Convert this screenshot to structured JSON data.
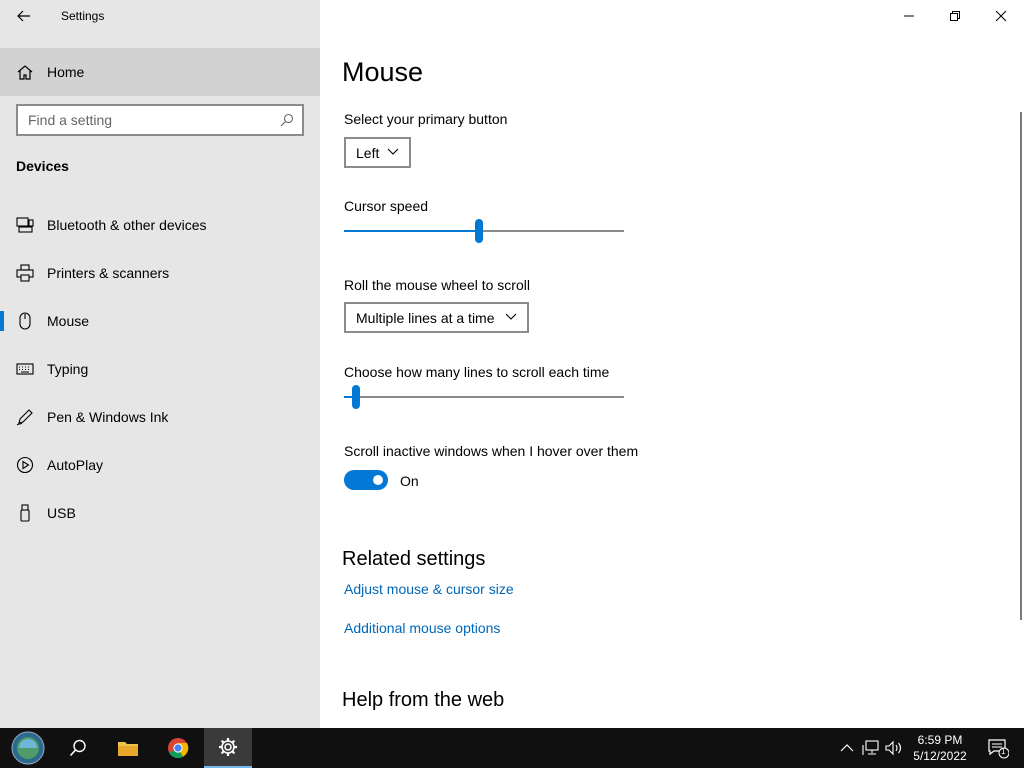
{
  "window": {
    "title": "Settings",
    "controls": {
      "minimize": "minimize",
      "maximize": "restore",
      "close": "close"
    }
  },
  "sidebar": {
    "home_label": "Home",
    "search_placeholder": "Find a setting",
    "section_heading": "Devices",
    "items": [
      {
        "label": "Bluetooth & other devices",
        "icon": "bluetooth-devices-icon",
        "selected": false
      },
      {
        "label": "Printers & scanners",
        "icon": "printer-icon",
        "selected": false
      },
      {
        "label": "Mouse",
        "icon": "mouse-icon",
        "selected": true
      },
      {
        "label": "Typing",
        "icon": "keyboard-icon",
        "selected": false
      },
      {
        "label": "Pen & Windows Ink",
        "icon": "pen-icon",
        "selected": false
      },
      {
        "label": "AutoPlay",
        "icon": "autoplay-icon",
        "selected": false
      },
      {
        "label": "USB",
        "icon": "usb-icon",
        "selected": false
      }
    ]
  },
  "main": {
    "title": "Mouse",
    "primary_button": {
      "label": "Select your primary button",
      "value": "Left"
    },
    "cursor_speed": {
      "label": "Cursor speed",
      "value_fraction": 0.48
    },
    "wheel_scroll": {
      "label": "Roll the mouse wheel to scroll",
      "value": "Multiple lines at a time"
    },
    "lines_to_scroll": {
      "label": "Choose how many lines to scroll each time",
      "value_fraction": 0.03
    },
    "scroll_inactive": {
      "label": "Scroll inactive windows when I hover over them",
      "state": "On"
    },
    "related": {
      "title": "Related settings",
      "links": [
        "Adjust mouse & cursor size",
        "Additional mouse options"
      ]
    },
    "help_title": "Help from the web"
  },
  "taskbar": {
    "time": "6:59 PM",
    "date": "5/12/2022",
    "notification_count": "1"
  },
  "colors": {
    "accent": "#0078d4",
    "link": "#0067b8",
    "sidebar_bg": "#e6e6e6",
    "taskbar_bg": "#101010"
  }
}
